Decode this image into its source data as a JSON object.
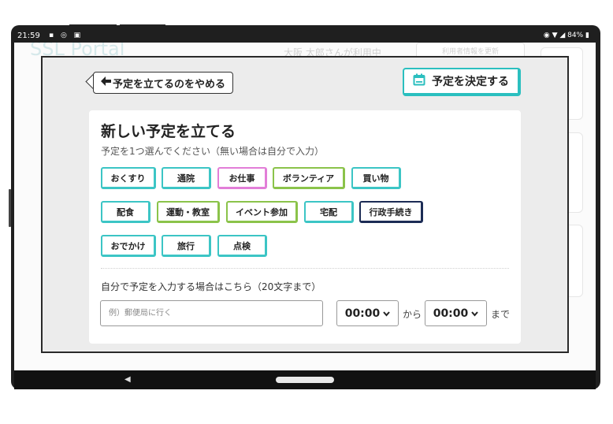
{
  "status_bar": {
    "time": "21:59",
    "left_icons": "▪ ◎ ▣",
    "right_icons": "◉ ▼ ◢ 84% ▮"
  },
  "background": {
    "logo": "SSL Portal",
    "user_text": "大阪 太郎さんが利用中",
    "user_button": "利用者情報を更新"
  },
  "modal": {
    "cancel_button": "予定を立てるのをやめる",
    "decide_button": "予定を決定する",
    "title": "新しい予定を立てる",
    "subtitle": "予定を1つ選んでください（無い場合は自分で入力）",
    "chips": {
      "okusuri": "おくすり",
      "tsuuin": "通院",
      "oshigoto": "お仕事",
      "volunteer": "ボランティア",
      "kaimono": "買い物",
      "haishoku": "配食",
      "undou": "運動・教室",
      "event": "イベント参加",
      "takuhai": "宅配",
      "gyousei": "行政手続き",
      "odekake": "おでかけ",
      "ryokou": "旅行",
      "tenken": "点検"
    },
    "free_input_label": "自分で予定を入力する場合はこちら（20文字まで）",
    "free_input_placeholder": "例）郵便局に行く",
    "start_time": "00:00",
    "from_text": "から",
    "end_time": "00:00",
    "until_text": "まで"
  },
  "colors": {
    "teal": "#3cc5c5",
    "green": "#8bc34a",
    "pink": "#e27ed8",
    "navy": "#1c2c55"
  }
}
